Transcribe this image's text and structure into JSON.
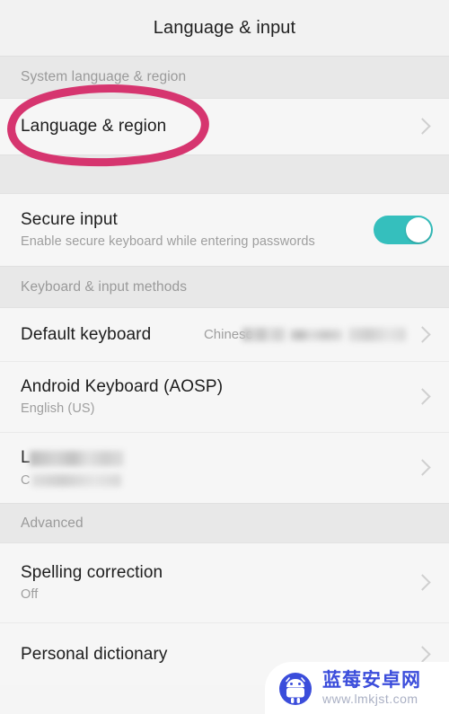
{
  "header": {
    "title": "Language & input"
  },
  "sections": [
    {
      "id": "system-language-region",
      "header": "System language & region",
      "rows": [
        {
          "id": "language-region",
          "title": "Language & region",
          "subtitle": "",
          "value": "",
          "accessory": "chevron-right-icon"
        }
      ]
    },
    {
      "id": "secure-input",
      "header": "",
      "rows": [
        {
          "id": "secure-input",
          "title": "Secure input",
          "subtitle": "Enable secure keyboard while entering passwords",
          "value": "",
          "accessory": "toggle-switch",
          "toggle_on": true
        }
      ]
    },
    {
      "id": "keyboard-input-methods",
      "header": "Keyboard & input methods",
      "rows": [
        {
          "id": "default-keyboard",
          "title": "Default keyboard",
          "subtitle": "",
          "value": "Chinese",
          "value_redacted": true,
          "accessory": "chevron-right-icon"
        },
        {
          "id": "android-keyboard-aosp",
          "title": "Android Keyboard (AOSP)",
          "subtitle": "English (US)",
          "value": "",
          "accessory": "chevron-right-icon"
        },
        {
          "id": "redacted-keyboard",
          "title": "L",
          "title_redacted": true,
          "subtitle": "C",
          "subtitle_redacted": true,
          "value": "",
          "accessory": "chevron-right-icon"
        }
      ]
    },
    {
      "id": "advanced",
      "header": "Advanced",
      "rows": [
        {
          "id": "spelling-correction",
          "title": "Spelling correction",
          "subtitle": "Off",
          "value": "",
          "accessory": "chevron-right-icon"
        },
        {
          "id": "personal-dictionary",
          "title": "Personal dictionary",
          "subtitle": "",
          "value": "",
          "accessory": "chevron-right-icon"
        }
      ]
    }
  ],
  "annotation": {
    "kind": "hand-drawn-oval",
    "color": "#d6356f",
    "targets": "language-region"
  },
  "watermark": {
    "brand_cn": "蓝莓安卓网",
    "url": "www.lmkjst.com",
    "logo": "android-robot-icon",
    "brand_color": "#3b4ddb"
  },
  "colors": {
    "accent_toggle": "#35bfbd",
    "annotation_pink": "#d6356f",
    "section_band": "#e8e8e8",
    "row_background": "#f6f6f6",
    "title_bar": "#f2f2f2"
  }
}
